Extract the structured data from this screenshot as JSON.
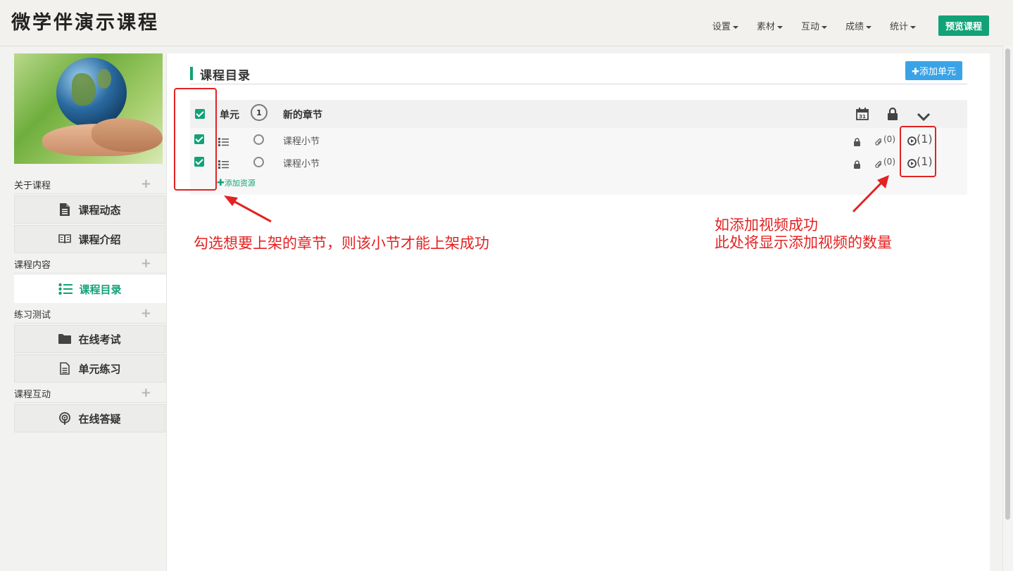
{
  "app": {
    "title": "微学伴演示课程"
  },
  "nav": {
    "items": [
      {
        "label": "设置"
      },
      {
        "label": "素材"
      },
      {
        "label": "互动"
      },
      {
        "label": "成绩"
      },
      {
        "label": "统计"
      }
    ],
    "preview_label": "预览课程"
  },
  "sidebar": {
    "sections": [
      {
        "title": "关于课程",
        "items": [
          {
            "label": "课程动态",
            "icon": "document-icon"
          },
          {
            "label": "课程介绍",
            "icon": "book-icon"
          }
        ]
      },
      {
        "title": "课程内容",
        "items": [
          {
            "label": "课程目录",
            "icon": "list-icon"
          }
        ]
      },
      {
        "title": "练习测试",
        "items": [
          {
            "label": "在线考试",
            "icon": "folder-icon"
          },
          {
            "label": "单元练习",
            "icon": "document-icon"
          }
        ]
      },
      {
        "title": "课程互动",
        "items": [
          {
            "label": "在线答疑",
            "icon": "podcast-icon"
          }
        ]
      }
    ]
  },
  "main": {
    "title": "课程目录",
    "add_unit_label": "✚添加单元",
    "unit": {
      "label": "单元",
      "number": "1",
      "name": "新的章节",
      "lessons": [
        {
          "name": "课程小节",
          "attachments": "(0)",
          "videos": "(1)"
        },
        {
          "name": "课程小节",
          "attachments": "(0)",
          "videos": "(1)"
        }
      ],
      "add_resource_label": "添加资源"
    }
  },
  "annotations": {
    "left_text": "勾选想要上架的章节，则该小节才能上架成功",
    "right_text_line1": "如添加视频成功",
    "right_text_line2": "此处将显示添加视频的数量"
  },
  "colors": {
    "accent": "#12a277",
    "blue": "#3aa3e8",
    "annotation": "#e32222"
  }
}
